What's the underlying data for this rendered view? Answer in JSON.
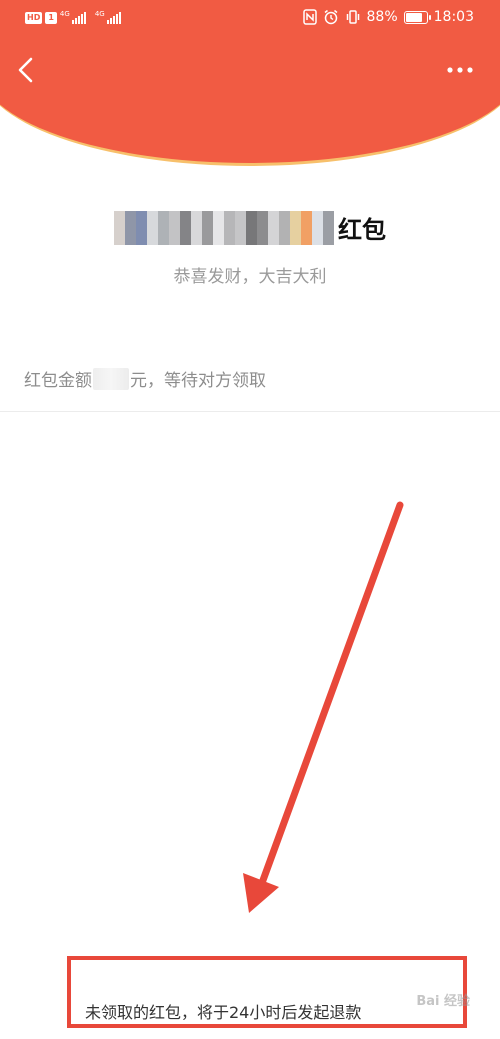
{
  "colors": {
    "header_red": "#f15b43",
    "header_edge": "#f7c06b",
    "annotation_red": "#e8483a",
    "muted_text": "#9a9a9a"
  },
  "status_bar": {
    "hd_badge": "HD",
    "sim_badge": "1",
    "network_1": "4G",
    "network_2": "4G",
    "battery_percent": "88%",
    "time": "18:03"
  },
  "header": {
    "back_icon": "chevron-left-icon",
    "more_icon": "more-horizontal-icon"
  },
  "sender": {
    "name_blurred_colors": [
      "#cfc8c3",
      "#8f96a8",
      "#7f8db0",
      "#d0d2d6",
      "#aeb2b6",
      "#c3c3c5",
      "#6f6f72",
      "#d8d8da",
      "#9a9a9c",
      "#e2e2e4",
      "#b6b6b8",
      "#c5c5c7",
      "#5f5f62",
      "#8c8c8e",
      "#d4d4d6",
      "#a4a4a6",
      "#e6d0a0",
      "#f1a064",
      "#d6dbe2",
      "#9b9ea4"
    ],
    "name_suffix": "红包"
  },
  "blessing": "恭喜发财，大吉大利",
  "amount": {
    "prefix": "红包金额",
    "suffix": "元，等待对方领取"
  },
  "refund_note": "未领取的红包，将于24小时后发起退款",
  "watermark": "Bai 经验"
}
